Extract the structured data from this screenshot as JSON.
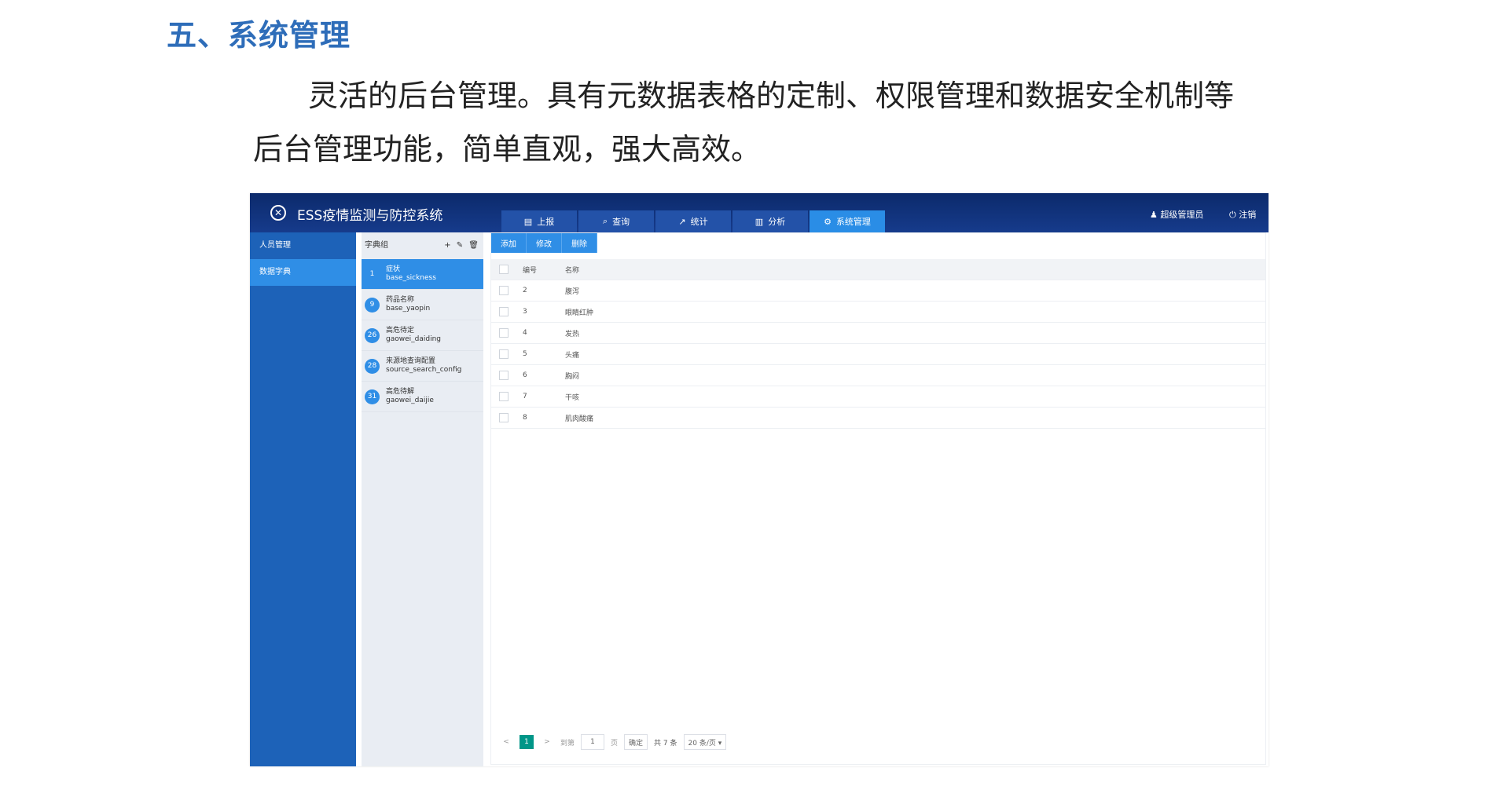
{
  "heading": "五、系统管理",
  "intro": {
    "line1": "灵活的后台管理。具有元数据表格的定制、权限管理和数据安全机制等",
    "line2": "后台管理功能，简单直观，强大高效。"
  },
  "app": {
    "title": "ESS疫情监测与防控系统",
    "logo_icon": "emblem-icon",
    "tabs": [
      {
        "label": "上报",
        "icon": "document-icon",
        "glyph": "▤"
      },
      {
        "label": "查询",
        "icon": "search-icon",
        "glyph": "⌕"
      },
      {
        "label": "统计",
        "icon": "line-chart-icon",
        "glyph": "↗"
      },
      {
        "label": "分析",
        "icon": "bar-chart-icon",
        "glyph": "▥"
      },
      {
        "label": "系统管理",
        "icon": "gears-icon",
        "glyph": "⚙"
      }
    ],
    "active_tab": "系统管理",
    "user": {
      "label": "超级管理员",
      "icon": "user-icon",
      "glyph": "♟"
    },
    "logout": {
      "label": "注销",
      "icon": "power-icon",
      "glyph": "⏻"
    },
    "sidebar": {
      "items": [
        {
          "label": "人员管理"
        },
        {
          "label": "数据字典"
        }
      ],
      "active": "数据字典"
    },
    "dictionary": {
      "header": "字典组",
      "tools": "+ ✎ 🗑",
      "items": [
        {
          "num": "1",
          "name": "症状",
          "code": "base_sickness"
        },
        {
          "num": "9",
          "name": "药品名称",
          "code": "base_yaopin"
        },
        {
          "num": "26",
          "name": "高危待定",
          "code": "gaowei_daiding"
        },
        {
          "num": "28",
          "name": "来源地查询配置",
          "code": "source_search_config"
        },
        {
          "num": "31",
          "name": "高危待解",
          "code": "gaowei_daijie"
        }
      ]
    },
    "actions": {
      "add": "添加",
      "edit": "修改",
      "delete": "删除"
    },
    "table": {
      "headers": [
        "编号",
        "名称"
      ],
      "rows": [
        [
          "2",
          "腹泻"
        ],
        [
          "3",
          "眼睛红肿"
        ],
        [
          "4",
          "发热"
        ],
        [
          "5",
          "头痛"
        ],
        [
          "6",
          "胸闷"
        ],
        [
          "7",
          "干咳"
        ],
        [
          "8",
          "肌肉酸痛"
        ]
      ]
    },
    "pagination": {
      "prev": "<",
      "current": "1",
      "next": ">",
      "goto_label": "到第",
      "goto_value": "1",
      "page_unit": "页",
      "confirm": "确定",
      "total": "共 7 条",
      "page_size": "20 条/页 ▾"
    }
  },
  "colors": {
    "heading": "#2e6db9",
    "topbar": "#0c2a6b",
    "sidebar": "#1d62b8",
    "accent": "#2f8ee6",
    "pager_current": "#009688"
  }
}
